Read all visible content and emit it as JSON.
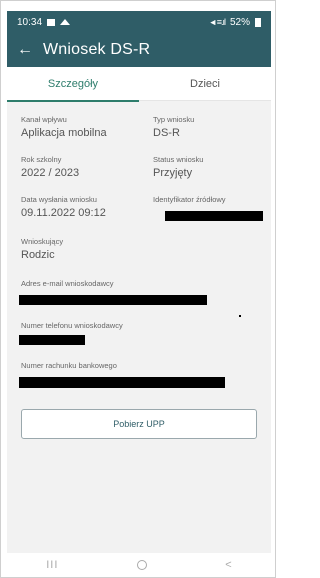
{
  "status_bar": {
    "time": "10:34",
    "signal_text": "◂ı ≡.ıl",
    "battery": "52%"
  },
  "app_bar": {
    "back_icon": "←",
    "title": "Wniosek DS-R"
  },
  "tabs": [
    {
      "label": "Szczegóły",
      "active": true
    },
    {
      "label": "Dzieci",
      "active": false
    }
  ],
  "details": {
    "kanal_label": "Kanał wpływu",
    "kanal_value": "Aplikacja mobilna",
    "typ_label": "Typ wniosku",
    "typ_value": "DS-R",
    "rok_label": "Rok szkolny",
    "rok_value": "2022 / 2023",
    "status_label": "Status wniosku",
    "status_value": "Przyjęty",
    "data_label": "Data wysłania wniosku",
    "data_value": "09.11.2022 09:12",
    "id_label": "Identyfikator źródłowy",
    "wnioskujacy_label": "Wnioskujący",
    "wnioskujacy_value": "Rodzic",
    "email_label": "Adres e-mail wnioskodawcy",
    "phone_label": "Numer telefonu wnioskodawcy",
    "bank_label": "Numer rachunku bankowego"
  },
  "buttons": {
    "pobierz_upp": "Pobierz UPP"
  },
  "nav": {
    "recent": "III",
    "back": "<"
  },
  "colors": {
    "accent": "#2f5d67",
    "tab_active": "#2e7d6c"
  }
}
